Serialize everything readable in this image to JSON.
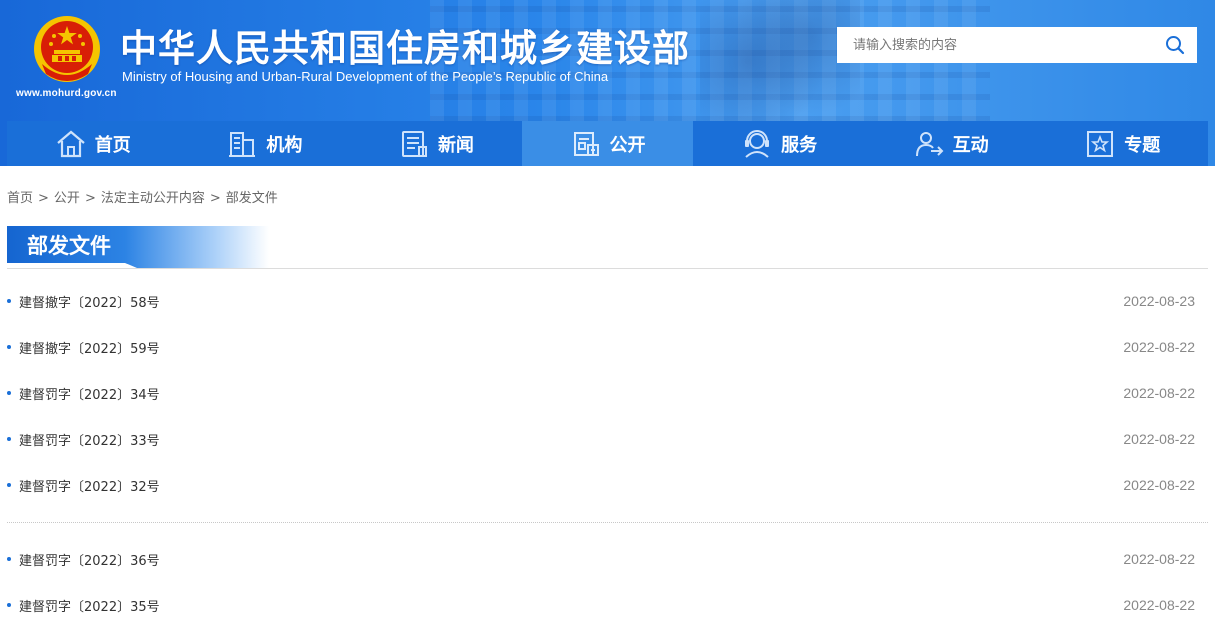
{
  "header": {
    "title_cn": "中华人民共和国住房和城乡建设部",
    "title_en": "Ministry of Housing and Urban-Rural Development of the People’s Republic of China",
    "url": "www.mohurd.gov.cn",
    "emblem_icon": "national-emblem-icon"
  },
  "search": {
    "placeholder": "请输入搜索的内容",
    "icon": "search-icon"
  },
  "nav": [
    {
      "label": "首页",
      "icon": "home-icon"
    },
    {
      "label": "机构",
      "icon": "building-icon"
    },
    {
      "label": "新闻",
      "icon": "news-icon"
    },
    {
      "label": "公开",
      "icon": "disclosure-icon",
      "active": true
    },
    {
      "label": "服务",
      "icon": "service-icon"
    },
    {
      "label": "互动",
      "icon": "interaction-icon"
    },
    {
      "label": "专题",
      "icon": "topic-star-icon"
    }
  ],
  "breadcrumb": [
    "首页",
    "公开",
    "法定主动公开内容",
    "部发文件"
  ],
  "breadcrumb_sep": ">",
  "section": {
    "title": "部发文件"
  },
  "documents_group1": [
    {
      "title": "建督撤字〔2022〕58号",
      "date": "2022-08-23"
    },
    {
      "title": "建督撤字〔2022〕59号",
      "date": "2022-08-22"
    },
    {
      "title": "建督罚字〔2022〕34号",
      "date": "2022-08-22"
    },
    {
      "title": "建督罚字〔2022〕33号",
      "date": "2022-08-22"
    },
    {
      "title": "建督罚字〔2022〕32号",
      "date": "2022-08-22"
    }
  ],
  "documents_group2": [
    {
      "title": "建督罚字〔2022〕36号",
      "date": "2022-08-22"
    },
    {
      "title": "建督罚字〔2022〕35号",
      "date": "2022-08-22"
    }
  ],
  "colors": {
    "brand_blue": "#1a6fd8",
    "nav_active": "#3a8ee6",
    "emblem_red": "#d81e06",
    "emblem_gold": "#f5c400"
  }
}
